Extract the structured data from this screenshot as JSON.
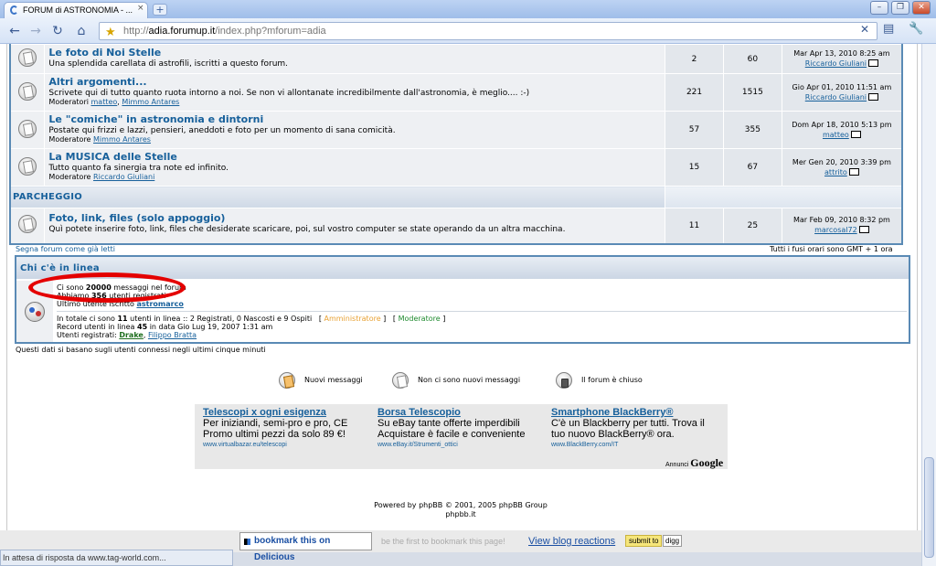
{
  "browser": {
    "tab_title": "FORUM di ASTRONOMIA - ...",
    "tab_close": "×",
    "new_tab": "+",
    "url_prefix": "http://",
    "url_domain": "adia.forumup.it",
    "url_path": "/index.php?mforum=adia",
    "status": "In attesa di risposta da www.tag-world.com..."
  },
  "forums": [
    {
      "name": "Le foto di Noi Stelle",
      "desc": "Una splendida carellata di astrofili, iscritti a questo forum.",
      "mods_label": "",
      "mods": [],
      "topics": "2",
      "posts": "60",
      "last_date": "Mar Apr 13, 2010 8:25 am",
      "last_user": "Riccardo Giuliani"
    },
    {
      "name": "Altri argomenti...",
      "desc": "Scrivete qui di tutto quanto ruota intorno a noi. Se non vi allontanate incredibilmente dall'astronomia, è meglio.... :-)",
      "mods_label": "Moderatori",
      "mods": [
        "matteo",
        "Mimmo Antares"
      ],
      "topics": "221",
      "posts": "1515",
      "last_date": "Gio Apr 01, 2010 11:51 am",
      "last_user": "Riccardo Giuliani"
    },
    {
      "name": "Le \"comiche\" in astronomia e dintorni",
      "desc": "Postate qui frizzi e lazzi, pensieri, aneddoti e foto per un momento di sana comicità.",
      "mods_label": "Moderatore",
      "mods": [
        "Mimmo Antares"
      ],
      "topics": "57",
      "posts": "355",
      "last_date": "Dom Apr 18, 2010 5:13 pm",
      "last_user": "matteo"
    },
    {
      "name": "La MUSICA delle Stelle",
      "desc": "Tutto quanto fa sinergia tra note ed infinito.",
      "mods_label": "Moderatore",
      "mods": [
        "Riccardo Giuliani"
      ],
      "topics": "15",
      "posts": "67",
      "last_date": "Mer Gen 20, 2010 3:39 pm",
      "last_user": "attrito"
    }
  ],
  "category": "PARCHEGGIO",
  "parcheggio": {
    "name": "Foto, link, files (solo appoggio)",
    "desc": "Quì potete inserire foto, link, files che desiderate scaricare, poi, sul vostro computer se state operando da un altra macchina.",
    "topics": "11",
    "posts": "25",
    "last_date": "Mar Feb 09, 2010 8:32 pm",
    "last_user": "marcosal72"
  },
  "mark_read": "Segna forum come già letti",
  "timezone": "Tutti i fusi orari sono GMT + 1 ora",
  "online": {
    "title": "Chi c'è in linea",
    "posts_pre": "Ci sono ",
    "posts_count": "20000",
    "posts_post": " messaggi nel forum",
    "users_pre": "Abbiamo ",
    "users_count": "356",
    "users_post": " utenti registrati",
    "last_user_label": "Ultimo utente iscritto ",
    "last_user": "astromarco",
    "total_pre": "In totale ci sono ",
    "total_count": "11",
    "total_post": " utenti in linea :: 2 Registrati, 0 Nascosti e 9 Ospiti",
    "admin_label": "Amministratore",
    "mod_label": "Moderatore",
    "record_pre": "Record utenti in linea ",
    "record_count": "45",
    "record_post": " in data Gio Lug 19, 2007 1:31 am",
    "registered_label": "Utenti registrati: ",
    "registered_users": [
      "Drake",
      "Filippo Bratta"
    ],
    "note": "Questi dati si basano sugli utenti connessi negli ultimi cinque minuti"
  },
  "legend": {
    "new": "Nuovi messaggi",
    "no_new": "Non ci sono nuovi messaggi",
    "locked": "Il forum è chiuso"
  },
  "ads": [
    {
      "title": "Telescopi x ogni esigenza",
      "desc": "Per iniziandi, semi-pro e pro, CE Promo ultimi pezzi da solo 89 €!",
      "url": "www.virtualbazar.eu/telescopi"
    },
    {
      "title": "Borsa Telescopio",
      "desc": "Su eBay tante offerte imperdibili Acquistare è facile e conveniente",
      "url": "www.eBay.it/Strumenti_ottici"
    },
    {
      "title": "Smartphone BlackBerry®",
      "desc": "C'è un Blackberry per tutti. Trova il tuo nuovo BlackBerry® ora.",
      "url": "www.BlackBerry.com/IT"
    }
  ],
  "ads_by": "Annunci",
  "ads_brand": "Google",
  "powered": "Powered by phpBB © 2001, 2005 phpBB Group",
  "powered_site": "phpbb.it",
  "bookmark": {
    "delicious": "bookmark this on Delicious",
    "first": "be the first to bookmark this page!",
    "blog": "View blog reactions",
    "submit": "submit to",
    "digg": "digg"
  }
}
